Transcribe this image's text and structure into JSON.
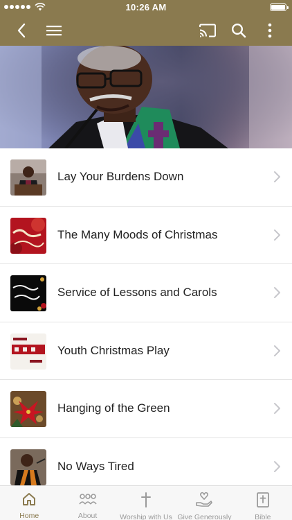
{
  "status_bar": {
    "time": "10:26 AM"
  },
  "nav": {
    "back_icon": "chevron-left-icon",
    "menu_icon": "hamburger-menu-icon",
    "cast_icon": "cast-icon",
    "search_icon": "search-icon",
    "more_icon": "more-vertical-icon"
  },
  "colors": {
    "brand": "#8a7a4f",
    "tab_inactive": "#9a9a9a",
    "divider": "#e4e4e4"
  },
  "list": {
    "items": [
      {
        "label": "Lay Your Burdens Down",
        "thumb": "pastor-pulpit"
      },
      {
        "label": "The Many Moods of Christmas",
        "thumb": "moods-christmas"
      },
      {
        "label": "Service of Lessons and Carols",
        "thumb": "lessons-carols"
      },
      {
        "label": "Youth Christmas Play",
        "thumb": "youth-christmas"
      },
      {
        "label": "Hanging of the Green",
        "thumb": "poinsettia"
      },
      {
        "label": "No Ways Tired",
        "thumb": "pastor-robe"
      }
    ]
  },
  "tabs": [
    {
      "label": "Home",
      "icon": "home-icon",
      "active": true
    },
    {
      "label": "About",
      "icon": "people-icon",
      "active": false
    },
    {
      "label": "Worship with Us",
      "icon": "cross-icon",
      "active": false
    },
    {
      "label": "Give Generously",
      "icon": "giving-hand-icon",
      "active": false
    },
    {
      "label": "Bible",
      "icon": "bible-icon",
      "active": false
    }
  ]
}
